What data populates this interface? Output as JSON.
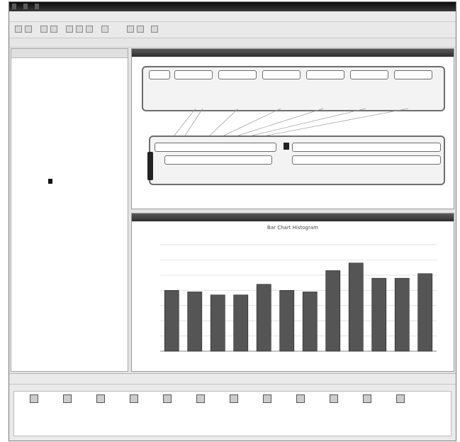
{
  "window": {
    "titles": [
      "",
      "",
      ""
    ]
  },
  "tree": {
    "selected_label": "",
    "nodes": []
  },
  "diagram": {
    "header": "",
    "top_fields": [
      "",
      "",
      "",
      "",
      "",
      ""
    ],
    "bottom_fields": [
      "",
      "",
      "",
      "",
      "",
      ""
    ]
  },
  "chart_data": {
    "type": "bar",
    "title": "Bar Chart Histogram",
    "categories": [
      "",
      "",
      "",
      "",
      "",
      "",
      "",
      "",
      "",
      "",
      "",
      ""
    ],
    "values": [
      200,
      195,
      185,
      185,
      220,
      200,
      195,
      265,
      290,
      240,
      240,
      255
    ],
    "ylim": [
      0,
      350
    ],
    "grid": true,
    "bar_color": "#555555"
  },
  "bottom": {
    "tabs": [
      "",
      "",
      "",
      "",
      "",
      "",
      "",
      "",
      "",
      ""
    ],
    "tools": [
      {
        "icon": "table-icon",
        "label": ""
      },
      {
        "icon": "grid-icon",
        "label": ""
      },
      {
        "icon": "chart-icon",
        "label": ""
      },
      {
        "icon": "image-icon",
        "label": ""
      },
      {
        "icon": "frame-icon",
        "label": ""
      },
      {
        "icon": "funnel-icon",
        "label": ""
      },
      {
        "icon": "arrows-icon",
        "label": ""
      },
      {
        "icon": "join-icon",
        "label": ""
      },
      {
        "icon": "sigma-icon",
        "label": ""
      },
      {
        "icon": "calc-icon",
        "label": ""
      },
      {
        "icon": "report-icon",
        "label": ""
      },
      {
        "icon": "loop-icon",
        "label": ""
      }
    ]
  }
}
